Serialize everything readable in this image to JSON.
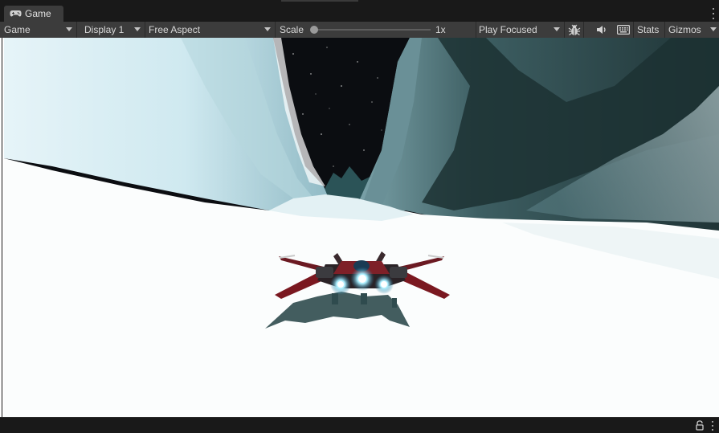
{
  "tab": {
    "label": "Game",
    "icon": "gamepad-icon"
  },
  "toolbar": {
    "mode_dropdown": "Game",
    "display_dropdown": "Display 1",
    "aspect_dropdown": "Free Aspect",
    "scale_label": "Scale",
    "scale_value": "1x",
    "scale_level": 0,
    "play_mode_dropdown": "Play Focused",
    "stats_label": "Stats",
    "gizmos_label": "Gizmos",
    "icons": [
      "bug-icon",
      "speaker-icon",
      "keyboard-icon"
    ]
  },
  "statusbar": {
    "icons": [
      "lock-icon",
      "kebab-menu-icon"
    ]
  },
  "colors": {
    "panel_bg": "#191919",
    "toolbar_bg": "#3c3c3c",
    "text": "#d8d8d8",
    "snow": "#ffffff",
    "sky": "#0c0e12",
    "shadow_teal": "#2e4648",
    "ship_red": "#7a1820",
    "engine_glow": "#9fe8ff"
  }
}
